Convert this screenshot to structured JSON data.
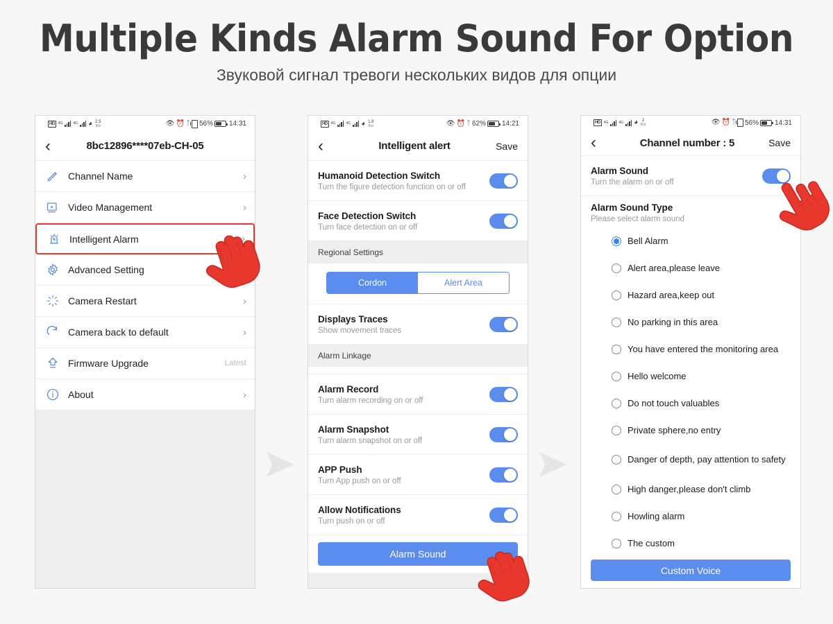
{
  "header": {
    "title": "Multiple Kinds Alarm Sound For Option",
    "subtitle": "Звуковой сигнал тревоги нескольких видов для опции"
  },
  "colors": {
    "accent_blue": "#5b8def",
    "radio_selected": "#3a82f0",
    "highlight_red": "#e13b30",
    "page_background": "#f7f7f7",
    "section_gray": "#efefef"
  },
  "phone1": {
    "status": {
      "hd_label": "HD",
      "network_label": "4G",
      "data_rate": "2.5",
      "data_rate_unit": "K/s",
      "battery_percent": "56%",
      "clock": "14:31",
      "icons": [
        "hd-icon",
        "signal-4g-icon",
        "signal-4g-icon",
        "wifi-icon",
        "eye-icon",
        "alarm-clock-icon",
        "bluetooth-icon",
        "vibrate-icon",
        "battery-icon"
      ]
    },
    "nav": {
      "back_icon": "chevron-left-icon",
      "title": "8bc12896****07eb-CH-05"
    },
    "menu": [
      {
        "label": "Channel Name",
        "icon": "pencil-icon",
        "accessory": "chevron"
      },
      {
        "label": "Video Management",
        "icon": "video-play-icon",
        "accessory": "chevron"
      },
      {
        "label": "Intelligent Alarm",
        "icon": "alarm-siren-icon",
        "accessory": "chevron",
        "highlighted": true
      },
      {
        "label": "Advanced Setting",
        "icon": "gear-icon",
        "accessory": "chevron"
      },
      {
        "label": "Camera Restart",
        "icon": "restart-burst-icon",
        "accessory": "chevron"
      },
      {
        "label": "Camera back to default",
        "icon": "refresh-icon",
        "accessory": "chevron"
      },
      {
        "label": "Firmware Upgrade",
        "icon": "upload-arrow-icon",
        "accessory": "text",
        "accessory_text": "Latest"
      },
      {
        "label": "About",
        "icon": "info-icon",
        "accessory": "chevron"
      }
    ]
  },
  "phone2": {
    "status": {
      "hd_label": "HD",
      "network_label": "4G",
      "data_rate": "1.8",
      "data_rate_unit": "K/s",
      "battery_percent": "62%",
      "clock": "14:21"
    },
    "nav": {
      "back_icon": "chevron-left-icon",
      "title": "Intelligent alert",
      "save_label": "Save"
    },
    "switches_top": [
      {
        "title": "Humanoid Detection Switch",
        "subtitle": "Turn the figure detection function on or off",
        "on": true
      },
      {
        "title": "Face Detection Switch",
        "subtitle": "Turn face detection on or off",
        "on": true
      }
    ],
    "section_regional": "Regional Settings",
    "segmented": {
      "options": [
        "Cordon",
        "Alert Area"
      ],
      "selected": "Cordon"
    },
    "displays_traces": {
      "title": "Displays Traces",
      "subtitle": "Show movement traces",
      "on": true
    },
    "section_linkage": "Alarm Linkage",
    "switches_linkage": [
      {
        "title": "Alarm Record",
        "subtitle": "Turn alarm recording on or off",
        "on": true
      },
      {
        "title": "Alarm Snapshot",
        "subtitle": "Turn alarm snapshot on or off",
        "on": true
      },
      {
        "title": "APP Push",
        "subtitle": "Turn App push on or off",
        "on": true
      },
      {
        "title": "Allow Notifications",
        "subtitle": "Turn push on or off",
        "on": true
      }
    ],
    "alarm_sound_button": "Alarm Sound"
  },
  "phone3": {
    "status": {
      "hd_label": "HD",
      "network_label": "4G",
      "data_rate": "2",
      "data_rate_unit": "K/s",
      "battery_percent": "56%",
      "clock": "14:31"
    },
    "nav": {
      "back_icon": "chevron-left-icon",
      "title": "Channel number : 5",
      "save_label": "Save"
    },
    "alarm_sound": {
      "title": "Alarm Sound",
      "subtitle": "Turn the alarm on or off",
      "on": true
    },
    "sound_type": {
      "title": "Alarm Sound Type",
      "subtitle": "Please select alarm sound"
    },
    "options": [
      {
        "label": "Bell Alarm",
        "selected": true
      },
      {
        "label": "Alert area,please leave",
        "selected": false
      },
      {
        "label": "Hazard area,keep out",
        "selected": false
      },
      {
        "label": "No parking in this area",
        "selected": false
      },
      {
        "label": "You have entered the monitoring area",
        "selected": false
      },
      {
        "label": "Hello welcome",
        "selected": false
      },
      {
        "label": "Do not touch valuables",
        "selected": false
      },
      {
        "label": "Private sphere,no entry",
        "selected": false
      },
      {
        "label": "Danger of depth, pay attention to safety",
        "selected": false
      },
      {
        "label": "High danger,please don't climb",
        "selected": false
      },
      {
        "label": "Howling alarm",
        "selected": false
      },
      {
        "label": "The custom",
        "selected": false
      }
    ],
    "custom_voice_button": "Custom Voice"
  },
  "flow": {
    "arrow_icon": "flow-arrow-right-icon"
  },
  "cursors": {
    "hand_icon": "pointing-hand-cursor"
  }
}
